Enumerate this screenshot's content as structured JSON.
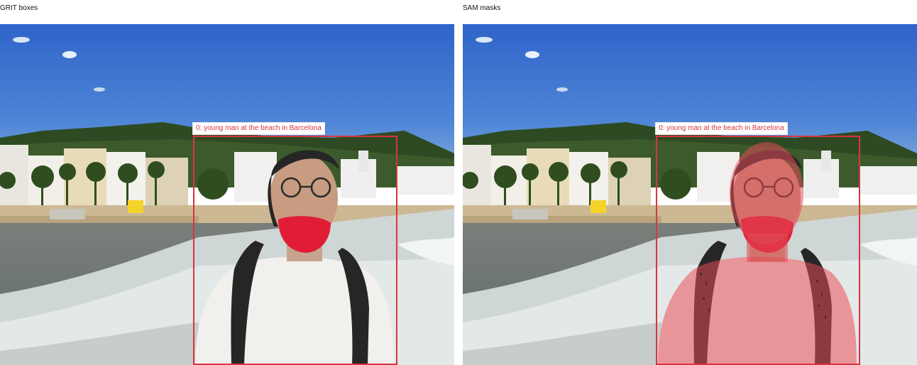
{
  "panels": [
    {
      "title": "GRIT boxes",
      "box_label": "0: young man at the beach in Barcelona"
    },
    {
      "title": "SAM masks",
      "box_label": "0: young man at the beach in Barcelona"
    }
  ],
  "colors": {
    "box": "#d9353f",
    "mask": "#e04a55"
  }
}
